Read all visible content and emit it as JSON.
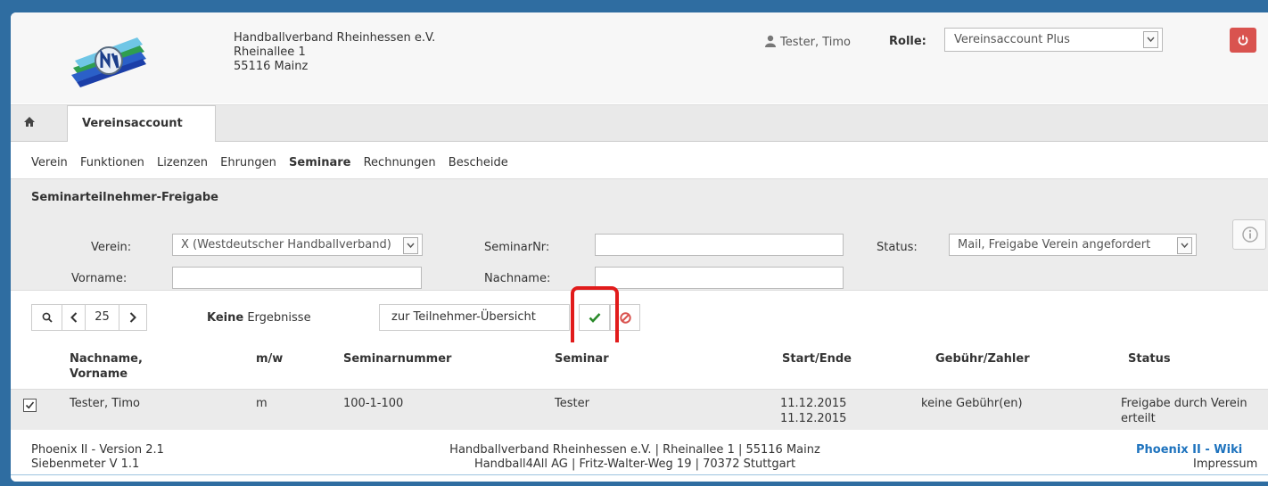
{
  "header": {
    "org_name": "Handballverband Rheinhessen e.V.",
    "org_street": "Rheinallee 1",
    "org_city": "55116 Mainz",
    "user_name": "Tester, Timo",
    "role_label": "Rolle:",
    "role_value": "Vereinsaccount Plus"
  },
  "tabs": {
    "active_tab": "Vereinsaccount"
  },
  "subnav": {
    "items": [
      "Verein",
      "Funktionen",
      "Lizenzen",
      "Ehrungen",
      "Seminare",
      "Rechnungen",
      "Bescheide"
    ],
    "active": "Seminare"
  },
  "filter": {
    "title": "Seminarteilnehmer-Freigabe",
    "verein_label": "Verein:",
    "verein_value": "X (Westdeutscher Handballverband)",
    "seminarnr_label": "SeminarNr:",
    "seminarnr_value": "",
    "status_label": "Status:",
    "status_value": "Mail, Freigabe Verein angefordert",
    "vorname_label": "Vorname:",
    "vorname_value": "",
    "nachname_label": "Nachname:",
    "nachname_value": ""
  },
  "toolbar": {
    "page_size": "25",
    "results_bold": "Keine",
    "results_text": "Ergebnisse",
    "overview_button": "zur Teilnehmer-Übersicht"
  },
  "table": {
    "columns": [
      "Nachname, Vorname",
      "m/w",
      "Seminarnummer",
      "Seminar",
      "Start/Ende",
      "Gebühr/Zahler",
      "Status"
    ],
    "rows": [
      {
        "name": "Tester, Timo",
        "gender": "m",
        "seminar_number": "100-1-100",
        "seminar": "Tester",
        "start": "11.12.2015",
        "end": "11.12.2015",
        "fee": "keine Gebühr(en)",
        "status_line1": "Freigabe durch Verein",
        "status_line2": "erteilt",
        "checked": true
      }
    ]
  },
  "footer": {
    "version": "Phoenix II - Version 2.1",
    "siebenmeter": "Siebenmeter V 1.1",
    "center_line1": "Handballverband Rheinhessen e.V. | Rheinallee 1 | 55116 Mainz",
    "center_line2": "Handball4All AG | Fritz-Walter-Weg 19 | 70372 Stuttgart",
    "wiki_link": "Phoenix II - Wiki",
    "impressum_link": "Impressum"
  },
  "colors": {
    "page_background": "#2f6da1",
    "logout_button": "#d9534f",
    "ok_check": "#2a8a2a",
    "cancel_icon": "#d9534f",
    "highlight_box": "#e11b1b",
    "link": "#1e73be"
  },
  "icons": [
    "user-icon",
    "chevron-down-icon",
    "power-icon",
    "home-icon",
    "info-icon",
    "search-icon",
    "chevron-left-icon",
    "chevron-right-icon",
    "checkmark-icon",
    "cancel-icon",
    "checkbox-icon"
  ]
}
